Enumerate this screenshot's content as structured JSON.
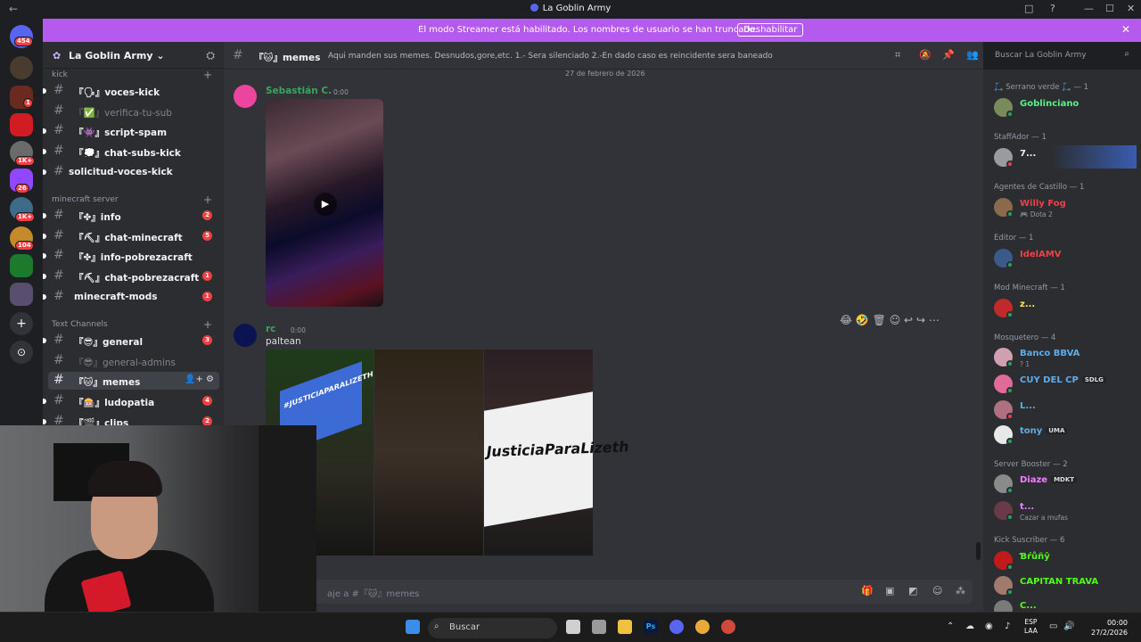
{
  "window": {
    "title": "La Goblin Army",
    "back": "←",
    "controls": [
      "□",
      "?",
      "—",
      "☐",
      "✕"
    ]
  },
  "streamer": {
    "message": "El modo Streamer está habilitado. Los nombres de usuario se han truncado.",
    "disable_label": "Deshabilitar",
    "close": "✕"
  },
  "guild_badges": [
    "454",
    "1",
    "1K+",
    "26",
    "1K+",
    "104"
  ],
  "server": {
    "name": "La Goblin Army",
    "chevron": "⌄"
  },
  "categories": {
    "kick": "kick",
    "minecraft": "minecraft server",
    "text": "Text Channels"
  },
  "channels": [
    {
      "name": "『🗣』voces-kick",
      "badge": ""
    },
    {
      "name": "『✅』verifica-tu-sub",
      "badge": ""
    },
    {
      "name": "『👾』script-spam",
      "badge": ""
    },
    {
      "name": "『💭』chat-subs-kick",
      "badge": ""
    },
    {
      "name": "solicitud-voces-kick",
      "badge": ""
    },
    {
      "name": "『✤』info",
      "badge": "2"
    },
    {
      "name": "『⛏』chat-minecraft",
      "badge": "5"
    },
    {
      "name": "『✤』info-pobrezacraft",
      "badge": ""
    },
    {
      "name": "『⛏』chat-pobrezacraft",
      "badge": "1"
    },
    {
      "name": "minecraft-mods",
      "badge": "1"
    },
    {
      "name": "『😎』general",
      "badge": "3"
    },
    {
      "name": "『😎』general-admins",
      "badge": ""
    },
    {
      "name": "『🐱』memes",
      "badge": ""
    },
    {
      "name": "『🎰』ludopatia",
      "badge": "4"
    },
    {
      "name": "『🎬』clips",
      "badge": "2"
    }
  ],
  "header": {
    "channel": "『🐱』memes",
    "topic": "Aqui manden sus memes. Desnudos,gore,etc. 1.- Sera silenciado 2.-En dado caso es reincidente sera baneado",
    "search_placeholder": "Buscar La Goblin Army"
  },
  "chat": {
    "date_divider": "27 de febrero de 2026",
    "messages": [
      {
        "author": "Sebastián C.",
        "time": "0:00"
      },
      {
        "author": "rc",
        "time": "0:00",
        "text": "paltean"
      }
    ],
    "banner_text": "JusticiaParaLizeth",
    "sign_text": "#JUSTICIAPARALIZETH",
    "composer_placeholder": "aje a #『🐱』memes"
  },
  "members": {
    "roles": [
      {
        "label": "🛴 Serrano verde 🛴 — 1"
      },
      {
        "label": "StaffAdor — 1"
      },
      {
        "label": "Agentes de Castillo — 1"
      },
      {
        "label": "Editor — 1"
      },
      {
        "label": "Mod Minecraft — 1"
      },
      {
        "label": "Mosquetero — 4"
      },
      {
        "label": "Server Booster — 2"
      },
      {
        "label": "Kick Suscriber — 6"
      }
    ],
    "list": [
      {
        "name": "Goblinciano",
        "sub": "",
        "tag": ""
      },
      {
        "name": "7...",
        "sub": "",
        "tag": ""
      },
      {
        "name": "Willy Fog",
        "sub": "🎮 Dota 2",
        "tag": ""
      },
      {
        "name": "IdelAMV",
        "sub": "",
        "tag": ""
      },
      {
        "name": "z...",
        "sub": "",
        "tag": ""
      },
      {
        "name": "Banco BBVA",
        "sub": "? 1",
        "tag": ""
      },
      {
        "name": "CUY DEL CP",
        "sub": "",
        "tag": "SDLG"
      },
      {
        "name": "L...",
        "sub": "",
        "tag": ""
      },
      {
        "name": "tony",
        "sub": "",
        "tag": "UMA"
      },
      {
        "name": "Diaze",
        "sub": "",
        "tag": "MDKT"
      },
      {
        "name": "t...",
        "sub": "Cazar a mufas",
        "tag": ""
      },
      {
        "name": "Ɓŕůñŷ",
        "sub": "",
        "tag": ""
      },
      {
        "name": "CAPITAN TRAVA",
        "sub": "",
        "tag": ""
      },
      {
        "name": "C...",
        "sub": "",
        "tag": ""
      }
    ]
  },
  "taskbar": {
    "search_placeholder": "Buscar",
    "lang_top": "ESP",
    "lang_bottom": "LAA",
    "time": "00:00",
    "date": "27/2/2026"
  }
}
